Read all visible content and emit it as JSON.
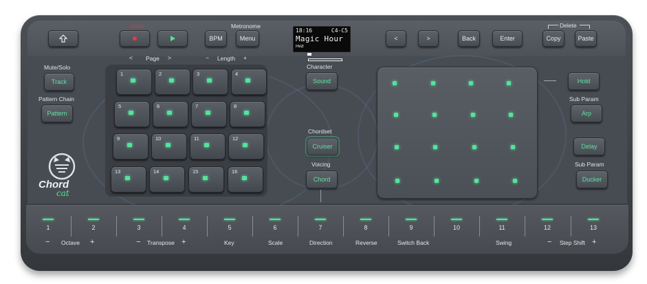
{
  "colors": {
    "accent_green": "#55e39b",
    "undo_red": "#c8404e",
    "body": "#474c52"
  },
  "top_labels": {
    "undo": "Undo",
    "metronome": "Metronome",
    "delete": "Delete"
  },
  "top_buttons": {
    "home_icon": "up-arrow-icon",
    "record_icon": "record-icon",
    "play_icon": "play-icon",
    "bpm": "BPM",
    "menu": "Menu",
    "left": "<",
    "right": ">",
    "back": "Back",
    "enter": "Enter",
    "copy": "Copy",
    "paste": "Paste"
  },
  "display": {
    "line1_left": "18:16",
    "line1_right": "C4-C5",
    "line2": "Magic Hour",
    "line3": "PAGE"
  },
  "pad_header": {
    "page_left": "<",
    "page": "Page",
    "page_right": ">",
    "length_minus": "−",
    "length": "Length",
    "length_plus": "+"
  },
  "left_controls": {
    "mute_solo_label": "Mute/Solo",
    "track": "Track",
    "pattern_chain_label": "Pattern Chain",
    "pattern": "Pattern",
    "logo_line1": "Chord",
    "logo_line2": "cat"
  },
  "pads": [
    "1",
    "2",
    "3",
    "4",
    "5",
    "6",
    "7",
    "8",
    "9",
    "10",
    "11",
    "12",
    "13",
    "14",
    "15",
    "16"
  ],
  "center_controls": {
    "character_label": "Character",
    "sound": "Sound",
    "chordset_label": "Chordset",
    "cruiser": "Cruiser",
    "voicing_label": "Voicing",
    "chord": "Chord"
  },
  "right_controls": {
    "hold": "Hold",
    "sub_param_1": "Sub Param",
    "arp": "Arp",
    "delay": "Delay",
    "sub_param_2": "Sub Param",
    "ducker": "Ducker"
  },
  "steps": [
    "1",
    "2",
    "3",
    "4",
    "5",
    "6",
    "7",
    "8",
    "9",
    "10",
    "11",
    "12",
    "13"
  ],
  "step_labels": {
    "octave_minus": "−",
    "octave": "Octave",
    "octave_plus": "+",
    "transpose_minus": "−",
    "transpose": "Transpose",
    "transpose_plus": "+",
    "key": "Key",
    "scale": "Scale",
    "direction": "Direction",
    "reverse": "Reverse",
    "switch_back": "Switch Back",
    "swing": "Swing",
    "step_shift_minus": "−",
    "step_shift": "Step Shift",
    "step_shift_plus": "+"
  }
}
